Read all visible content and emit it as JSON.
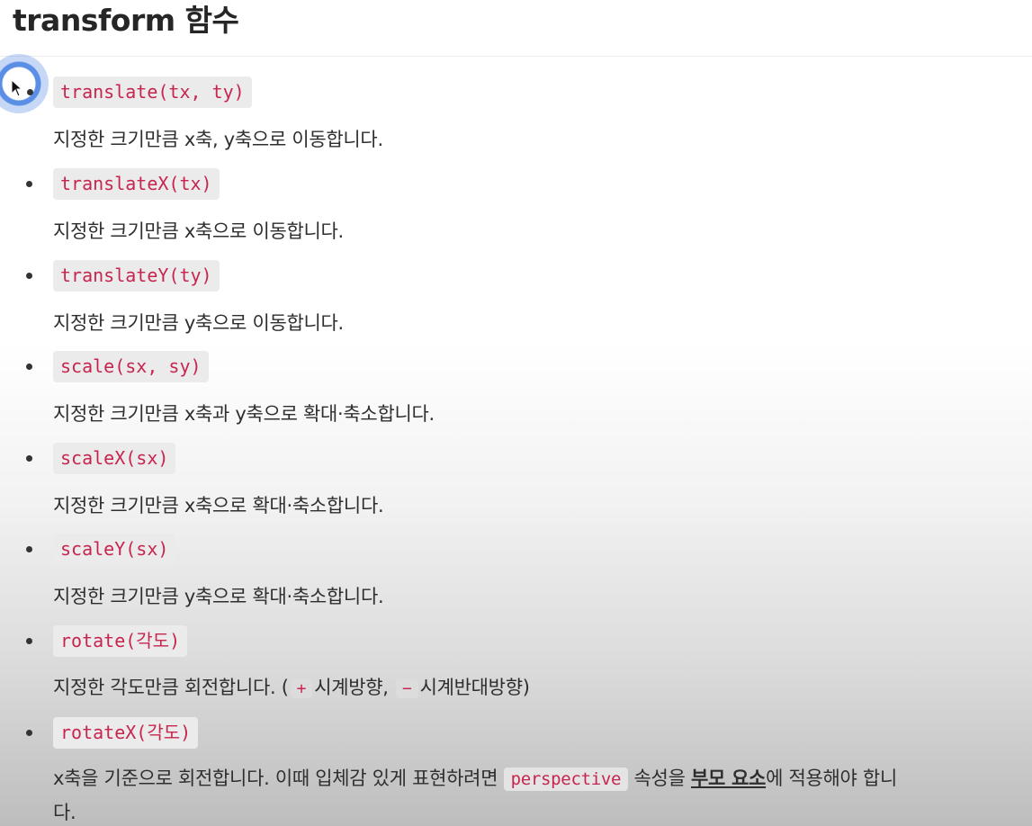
{
  "title": "transform 함수",
  "items": [
    {
      "code": "translate(tx, ty)",
      "desc": "지정한 크기만큼 x축, y축으로 이동합니다."
    },
    {
      "code": "translateX(tx)",
      "desc": "지정한 크기만큼 x축으로 이동합니다."
    },
    {
      "code": "translateY(ty)",
      "desc": "지정한 크기만큼 y축으로 이동합니다."
    },
    {
      "code": "scale(sx, sy)",
      "desc": "지정한 크기만큼 x축과 y축으로 확대·축소합니다."
    },
    {
      "code": "scaleX(sx)",
      "desc": "지정한 크기만큼 x축으로 확대·축소합니다."
    },
    {
      "code": "scaleY(sx)",
      "desc": "지정한 크기만큼 y축으로 확대·축소합니다."
    },
    {
      "code": "rotate(각도)"
    },
    {
      "code": "rotateX(각도)"
    }
  ],
  "rotate_desc": {
    "part1": "지정한 각도만큼 회전합니다. (",
    "plus": "+",
    "part2": "시계방향,",
    "minus": "−",
    "part3": "시계반대방향)"
  },
  "rotatex_desc": {
    "part1": "x축을 기준으로 회전합니다. 이때 입체감 있게 표현하려면",
    "code": "perspective",
    "part2": "속성을",
    "bold": "부모 요소",
    "part3": "에 적용해야 합니",
    "line2": "다."
  },
  "colors": {
    "code_text": "#c7254e",
    "code_bg": "#ebebeb",
    "cursor_ring": "#5b8fe6"
  }
}
